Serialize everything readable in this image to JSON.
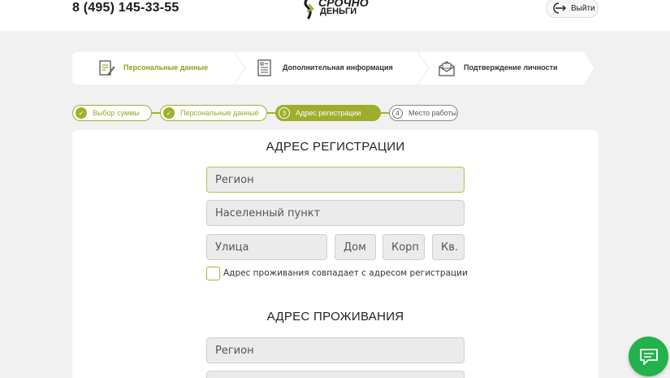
{
  "header": {
    "phone": "8 (495) 145-33-55",
    "logo_line1": "СРОЧНО",
    "logo_line2": "ДЕНЬГИ",
    "logout_label": "Выйти"
  },
  "steps": [
    {
      "label": "Персональные данные",
      "icon": "edit-document-icon",
      "active": true
    },
    {
      "label": "Дополнительная информация",
      "icon": "form-list-icon",
      "active": false
    },
    {
      "label": "Подтверждение личности",
      "icon": "envelope-icon",
      "active": false
    }
  ],
  "substeps": [
    {
      "label": "Выбор суммы",
      "state": "done",
      "mark": "✓"
    },
    {
      "label": "Персональные данные",
      "state": "done",
      "mark": "✓"
    },
    {
      "label": "Адрес регистрации",
      "state": "current",
      "mark": "3"
    },
    {
      "label": "Место работы",
      "state": "todo",
      "mark": "4"
    }
  ],
  "registration": {
    "title": "АДРЕС РЕГИСТРАЦИИ",
    "region_placeholder": "Регион",
    "locality_placeholder": "Населенный пункт",
    "street_placeholder": "Улица",
    "house_placeholder": "Дом",
    "building_placeholder": "Корп",
    "apartment_placeholder": "Кв.",
    "same_address_label": "Адрес проживания совпадает с адресом регистрации"
  },
  "residence": {
    "title": "АДРЕС ПРОЖИВАНИЯ",
    "region_placeholder": "Регион"
  },
  "colors": {
    "accent": "#9eae2a",
    "chat": "#22b24c"
  },
  "chat": {
    "icon": "chat-bubble-icon"
  }
}
